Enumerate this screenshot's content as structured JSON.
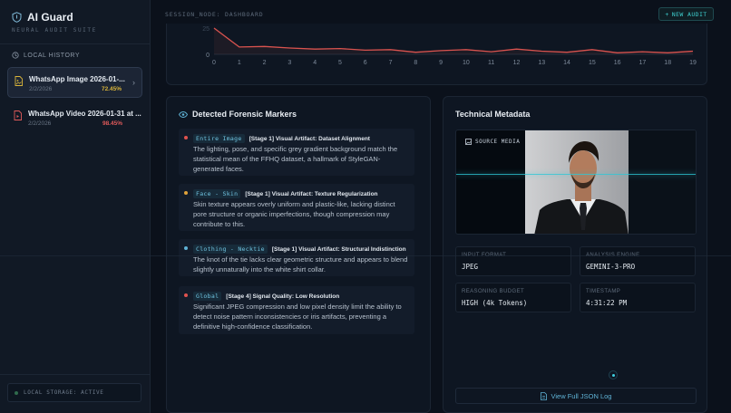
{
  "app": {
    "title": "AI Guard",
    "subtitle": "NEURAL AUDIT SUITE",
    "session": "SESSION_NODE: DASHBOARD",
    "new_audit_label": "NEW AUDIT"
  },
  "sidebar": {
    "history_label": "LOCAL HISTORY",
    "items": [
      {
        "name": "WhatsApp Image 2026-01-...",
        "date": "2/2/2026",
        "score": "72.45%",
        "score_color": "#d9b43a",
        "icon": "image-file-icon",
        "active": true
      },
      {
        "name": "WhatsApp Video 2026-01-31 at ...",
        "date": "2/2/2026",
        "score": "98.45%",
        "score_color": "#e05a5a",
        "icon": "video-file-icon",
        "active": false
      }
    ],
    "storage_status": "LOCAL STORAGE: ACTIVE"
  },
  "chart_data": {
    "type": "line",
    "x": [
      0,
      1,
      2,
      3,
      4,
      5,
      6,
      7,
      8,
      9,
      10,
      11,
      12,
      13,
      14,
      15,
      16,
      17,
      18,
      19
    ],
    "series": [
      {
        "values": [
          25,
          7,
          7.5,
          6,
          5,
          5.5,
          4,
          4.5,
          2,
          3.5,
          4.5,
          2.5,
          5,
          3,
          2,
          4.5,
          1.5,
          2.5,
          1.5,
          3
        ]
      }
    ],
    "visible_ytick": "25",
    "ytick_zero": "0",
    "line_color": "#d9534f"
  },
  "markers": {
    "title": "Detected Forensic Markers",
    "items": [
      {
        "tag": "Entire Image",
        "title": "[Stage 1] Visual Artifact: Dataset Alignment",
        "text": "The lighting, pose, and specific grey gradient background match the statistical mean of the FFHQ dataset, a hallmark of StyleGAN-generated faces.",
        "dot_color": "#e0534f"
      },
      {
        "tag": "Face - Skin",
        "title": "[Stage 1] Visual Artifact: Texture Regularization",
        "text": "Skin texture appears overly uniform and plastic-like, lacking distinct pore structure or organic imperfections, though compression may contribute to this.",
        "dot_color": "#e0a23a"
      },
      {
        "tag": "Clothing - Necktie",
        "title": "[Stage 1] Visual Artifact: Structural Indistinction",
        "text": "The knot of the tie lacks clear geometric structure and appears to blend slightly unnaturally into the white shirt collar.",
        "dot_color": "#5fb3d6"
      },
      {
        "tag": "Global",
        "title": "[Stage 4] Signal Quality: Low Resolution",
        "text": "Significant JPEG compression and low pixel density limit the ability to detect noise pattern inconsistencies or iris artifacts, preventing a definitive high-confidence classification.",
        "dot_color": "#e0534f"
      }
    ]
  },
  "metadata": {
    "title": "Technical Metadata",
    "source_label": "SOURCE MEDIA",
    "fields": [
      {
        "label": "INPUT FORMAT",
        "value": "JPEG"
      },
      {
        "label": "ANALYSIS ENGINE",
        "value": "GEMINI-3-PRO"
      },
      {
        "label": "REASONING BUDGET",
        "value": "HIGH (4k Tokens)"
      },
      {
        "label": "TIMESTAMP",
        "value": "4:31:22 PM"
      }
    ],
    "json_button_label": "View Full JSON Log"
  }
}
